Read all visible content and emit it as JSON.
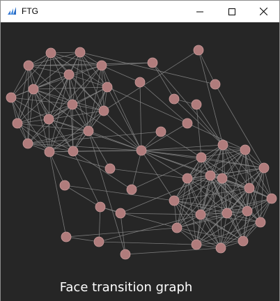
{
  "window": {
    "title": "FTG"
  },
  "graph": {
    "caption": "Face transition graph",
    "colors": {
      "background": "#262626",
      "node_fill": "#b07c7c",
      "node_stroke": "#c89a9a",
      "edge": "#8a8a8a"
    }
  }
}
